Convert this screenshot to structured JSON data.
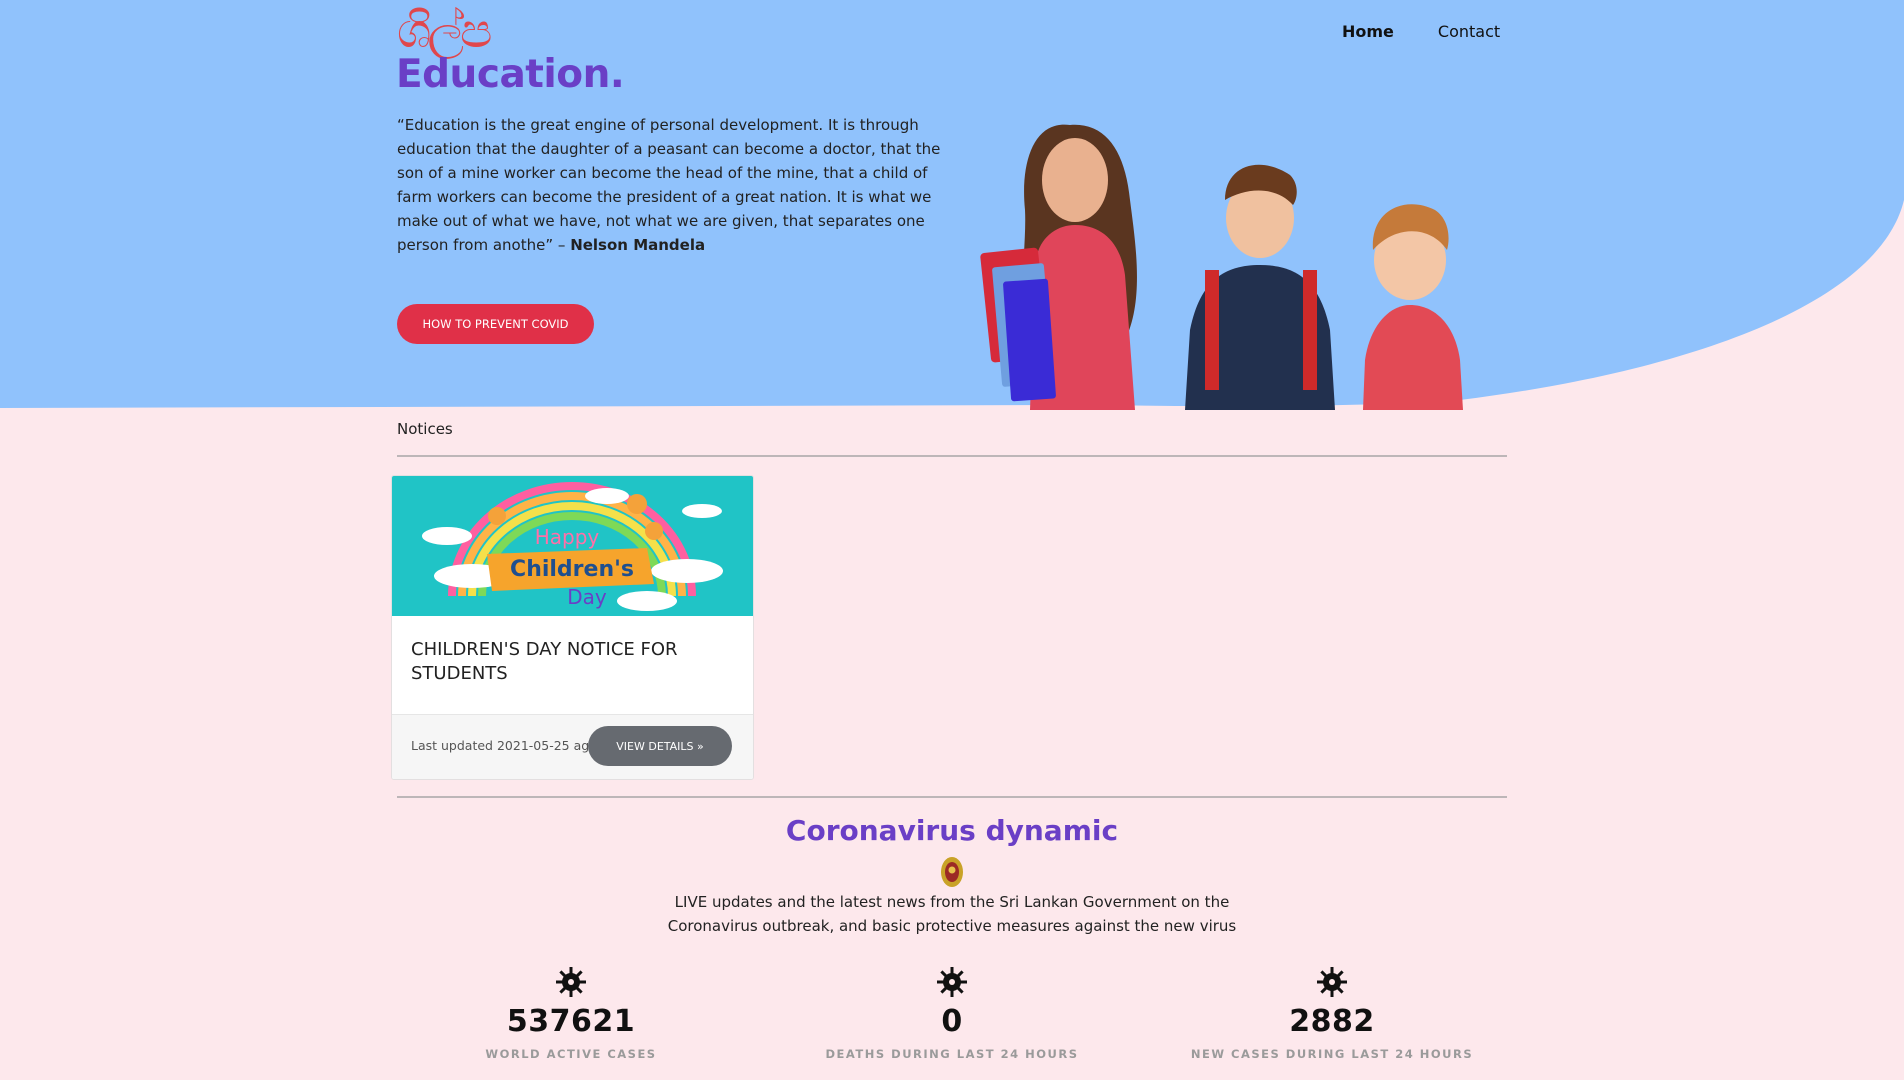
{
  "brand": {
    "logo_mark": "ශිල්ප",
    "logo_word": "Education.",
    "colors": {
      "hero_bg": "#90c2fc",
      "page_bg": "#fde8ec",
      "accent": "#6a3fc6",
      "button_red": "#e03048"
    }
  },
  "nav": {
    "home": "Home",
    "contact": "Contact"
  },
  "hero": {
    "quote": "“Education is the great engine of personal development. It is through education that the daughter of a peasant can become a doctor, that the son of a mine worker can become the head of the mine, that a child of farm workers can become the president of a great nation. It is what we make out of what we have, not what we are given, that separates one person from anothe” –",
    "author": "Nelson Mandela",
    "button": "HOW TO PREVENT COVID"
  },
  "notices": {
    "label": "Notices",
    "cards": [
      {
        "image_text_top": "Happy",
        "image_text_mid": "Children's",
        "image_text_bottom": "Day",
        "title": "CHILDREN'S DAY NOTICE FOR STUDENTS",
        "updated": "Last updated 2021-05-25 ago",
        "button": "VIEW DETAILS »"
      }
    ]
  },
  "corona": {
    "title": "Coronavirus dynamic",
    "description": "LIVE updates and the latest news from the Sri Lankan Government on the Coronavirus outbreak, and basic protective measures against the new virus",
    "stats": [
      {
        "value": "537621",
        "label": "WORLD ACTIVE CASES",
        "icon": "virus-icon"
      },
      {
        "value": "0",
        "label": "DEATHS DURING LAST 24 HOURS",
        "icon": "virus-icon"
      },
      {
        "value": "2882",
        "label": "NEW CASES DURING LAST 24 HOURS",
        "icon": "virus-icon"
      }
    ]
  }
}
